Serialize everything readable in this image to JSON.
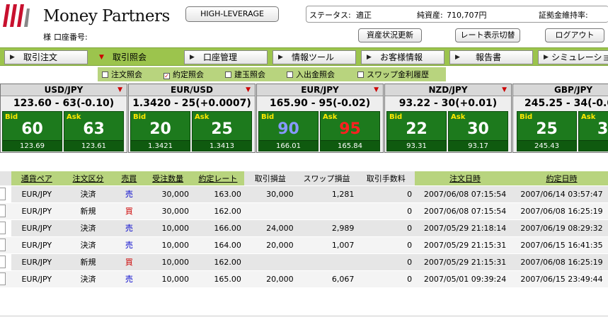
{
  "header": {
    "logo_text": "Money Partners",
    "account_honorific": "様",
    "account_label": "口座番号:",
    "leverage_button": "HIGH-LEVERAGE",
    "status_label": "ステータス:",
    "status_value": "適正",
    "net_assets_label": "純資産:",
    "net_assets_value": "710,707円",
    "margin_label": "証拠金維持率:",
    "refresh_button": "資産状況更新",
    "rate_toggle_button": "レート表示切替",
    "logout_button": "ログアウト"
  },
  "nav": {
    "items": [
      {
        "label": "取引注文",
        "active": false
      },
      {
        "label": "取引照会",
        "active": true
      },
      {
        "label": "口座管理",
        "active": false
      },
      {
        "label": "情報ツール",
        "active": false
      },
      {
        "label": "お客様情報",
        "active": false
      },
      {
        "label": "報告書",
        "active": false
      },
      {
        "label": "シミュレーション",
        "active": false
      }
    ]
  },
  "subnav": {
    "items": [
      {
        "label": "注文照会",
        "checked": false
      },
      {
        "label": "約定照会",
        "checked": true
      },
      {
        "label": "建玉照会",
        "checked": false
      },
      {
        "label": "入出金照会",
        "checked": false
      },
      {
        "label": "スワップ金利履歴",
        "checked": false
      }
    ]
  },
  "rates": [
    {
      "pair": "USD/JPY",
      "rate": "123.60 - 63(-0.10)",
      "bid_label": "Bid",
      "bid_big": "60",
      "bid_small": "123.69",
      "ask_label": "Ask",
      "ask_big": "63",
      "ask_small": "123.61",
      "bid_color": "#ffffff",
      "ask_color": "#ffffff"
    },
    {
      "pair": "EUR/USD",
      "rate": "1.3420 - 25(+0.0007)",
      "bid_label": "Bid",
      "bid_big": "20",
      "bid_small": "1.3421",
      "ask_label": "Ask",
      "ask_big": "25",
      "ask_small": "1.3413",
      "bid_color": "#ffffff",
      "ask_color": "#ffffff"
    },
    {
      "pair": "EUR/JPY",
      "rate": "165.90 - 95(-0.02)",
      "bid_label": "Bid",
      "bid_big": "90",
      "bid_small": "166.01",
      "ask_label": "Ask",
      "ask_big": "95",
      "ask_small": "165.84",
      "bid_color": "#8899ff",
      "ask_color": "#ff2020"
    },
    {
      "pair": "NZD/JPY",
      "rate": "93.22 - 30(+0.01)",
      "bid_label": "Bid",
      "bid_big": "22",
      "bid_small": "93.31",
      "ask_label": "Ask",
      "ask_big": "30",
      "ask_small": "93.17",
      "bid_color": "#ffffff",
      "ask_color": "#ffffff"
    },
    {
      "pair": "GBP/JPY",
      "rate": "245.25 - 34(-0.0",
      "bid_label": "Bid",
      "bid_big": "25",
      "bid_small": "245.43",
      "ask_label": "Ask",
      "ask_big": "3",
      "ask_small": "",
      "bid_color": "#ffffff",
      "ask_color": "#ffffff"
    }
  ],
  "table": {
    "columns": [
      "通貨ペア",
      "注文区分",
      "売買",
      "受注数量",
      "約定レート",
      "取引損益",
      "スワップ損益",
      "取引手数料",
      "注文日時",
      "約定日時"
    ],
    "rows": [
      [
        "EUR/JPY",
        "決済",
        "売",
        "30,000",
        "163.00",
        "30,000",
        "1,281",
        "0",
        "2007/06/08 07:15:54",
        "2007/06/14 03:57:47"
      ],
      [
        "EUR/JPY",
        "新規",
        "買",
        "30,000",
        "162.00",
        "",
        "",
        "0",
        "2007/06/08 07:15:54",
        "2007/06/08 16:25:19"
      ],
      [
        "EUR/JPY",
        "決済",
        "売",
        "10,000",
        "166.00",
        "24,000",
        "2,989",
        "0",
        "2007/05/29 21:18:14",
        "2007/06/19 08:29:32"
      ],
      [
        "EUR/JPY",
        "決済",
        "売",
        "10,000",
        "164.00",
        "20,000",
        "1,007",
        "0",
        "2007/05/29 21:15:31",
        "2007/06/15 16:41:35"
      ],
      [
        "EUR/JPY",
        "新規",
        "買",
        "10,000",
        "162.00",
        "",
        "",
        "0",
        "2007/05/29 21:15:31",
        "2007/06/08 16:25:19"
      ],
      [
        "EUR/JPY",
        "決済",
        "売",
        "10,000",
        "165.00",
        "20,000",
        "6,067",
        "0",
        "2007/05/01 09:39:24",
        "2007/06/15 23:49:44"
      ]
    ]
  },
  "colors": {
    "nav_green": "#9cc44d",
    "sub_green": "#b8d47e",
    "rate_box_green": "#1d7a1d",
    "sell_blue": "#0000cc",
    "buy_red": "#cc0000",
    "logo_red": "#c8102e"
  }
}
